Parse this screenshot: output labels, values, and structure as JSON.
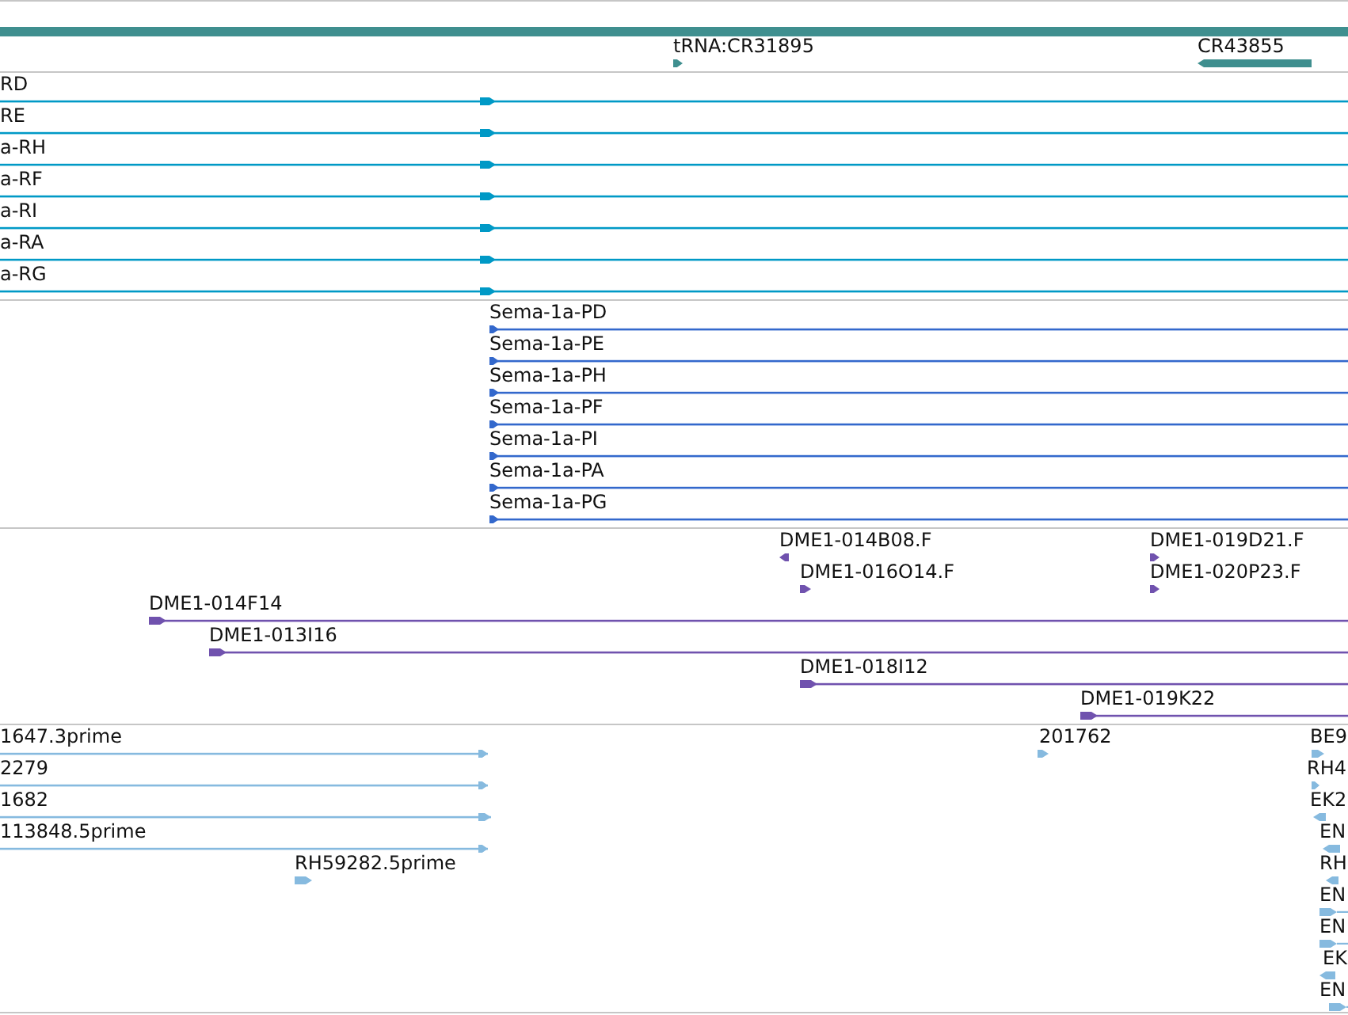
{
  "tracks": [
    {
      "color": "#3f8f8f",
      "rows": [
        {
          "features": [
            {
              "kind": "bar"
            }
          ]
        },
        {
          "features": [
            {
              "label": "tRNA:CR31895",
              "kind": "mark",
              "reverse": false
            },
            {
              "label": "CR43855",
              "kind": "bar",
              "reverse": true
            }
          ]
        }
      ]
    },
    {
      "color": "#0099c6",
      "rows": [
        {
          "features": [
            {
              "label": "RD",
              "kind": "line",
              "reverse": false
            }
          ]
        },
        {
          "features": [
            {
              "label": "RE",
              "kind": "line",
              "reverse": false
            }
          ]
        },
        {
          "features": [
            {
              "label": "a-RH",
              "kind": "line",
              "reverse": false
            }
          ]
        },
        {
          "features": [
            {
              "label": "a-RF",
              "kind": "line",
              "reverse": false
            }
          ]
        },
        {
          "features": [
            {
              "label": "a-RI",
              "kind": "line",
              "reverse": false
            }
          ]
        },
        {
          "features": [
            {
              "label": "a-RA",
              "kind": "line",
              "reverse": false
            }
          ]
        },
        {
          "features": [
            {
              "label": "a-RG",
              "kind": "line",
              "reverse": false
            }
          ]
        }
      ]
    },
    {
      "color": "#3368cc",
      "rows": [
        {
          "features": [
            {
              "label": "Sema-1a-PD",
              "kind": "line",
              "reverse": false
            }
          ]
        },
        {
          "features": [
            {
              "label": "Sema-1a-PE",
              "kind": "line",
              "reverse": false
            }
          ]
        },
        {
          "features": [
            {
              "label": "Sema-1a-PH",
              "kind": "line",
              "reverse": false
            }
          ]
        },
        {
          "features": [
            {
              "label": "Sema-1a-PF",
              "kind": "line",
              "reverse": false
            }
          ]
        },
        {
          "features": [
            {
              "label": "Sema-1a-PI",
              "kind": "line",
              "reverse": false
            }
          ]
        },
        {
          "features": [
            {
              "label": "Sema-1a-PA",
              "kind": "line",
              "reverse": false
            }
          ]
        },
        {
          "features": [
            {
              "label": "Sema-1a-PG",
              "kind": "line",
              "reverse": false
            }
          ]
        }
      ]
    },
    {
      "color": "#7052ae",
      "rows": [
        {
          "features": [
            {
              "label": "DME1-014B08.F",
              "kind": "mark",
              "reverse": true
            },
            {
              "label": "DME1-019D21.F",
              "kind": "mark",
              "reverse": false
            }
          ]
        },
        {
          "features": [
            {
              "label": "DME1-016O14.F",
              "kind": "mark",
              "reverse": false
            },
            {
              "label": "DME1-020P23.F",
              "kind": "mark",
              "reverse": false
            }
          ]
        },
        {
          "features": [
            {
              "label": "DME1-014F14",
              "kind": "line",
              "reverse": false
            }
          ]
        },
        {
          "features": [
            {
              "label": "DME1-013I16",
              "kind": "line",
              "reverse": false
            }
          ]
        },
        {
          "features": [
            {
              "label": "DME1-018I12",
              "kind": "line",
              "reverse": false
            }
          ]
        },
        {
          "features": [
            {
              "label": "DME1-019K22",
              "kind": "line",
              "reverse": false
            }
          ]
        }
      ]
    },
    {
      "color": "#86badf",
      "rows": [
        {
          "features": [
            {
              "label": "1647.3prime",
              "kind": "line",
              "reverse": false
            },
            {
              "label": "201762",
              "kind": "mark",
              "reverse": false
            },
            {
              "label": "BE9",
              "kind": "mark",
              "reverse": false
            }
          ]
        },
        {
          "features": [
            {
              "label": "2279",
              "kind": "line",
              "reverse": false
            },
            {
              "label": "RH4",
              "kind": "mark",
              "reverse": false
            }
          ]
        },
        {
          "features": [
            {
              "label": "1682",
              "kind": "line",
              "reverse": false
            },
            {
              "label": "EK2",
              "kind": "mark",
              "reverse": true
            }
          ]
        },
        {
          "features": [
            {
              "label": "113848.5prime",
              "kind": "line",
              "reverse": false
            },
            {
              "label": "EN",
              "kind": "mark",
              "reverse": true
            }
          ]
        },
        {
          "features": [
            {
              "label": "RH59282.5prime",
              "kind": "mark",
              "reverse": false
            },
            {
              "label": "RH",
              "kind": "mark",
              "reverse": true
            }
          ]
        },
        {
          "features": [
            {
              "label": "EN",
              "kind": "mark",
              "reverse": false
            }
          ]
        },
        {
          "features": [
            {
              "label": "EN",
              "kind": "mark",
              "reverse": false
            }
          ]
        },
        {
          "features": [
            {
              "label": "EK",
              "kind": "mark",
              "reverse": true
            }
          ]
        },
        {
          "features": [
            {
              "label": "EN",
              "kind": "mark",
              "reverse": false
            }
          ]
        }
      ]
    }
  ]
}
